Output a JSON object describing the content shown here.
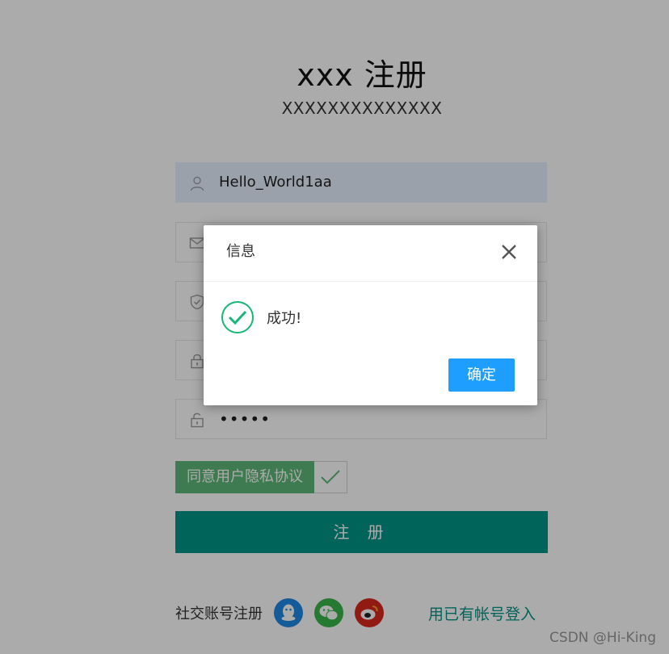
{
  "header": {
    "title": "xxx 注册",
    "subtitle": "XXXXXXXXXXXXXX"
  },
  "form": {
    "username_value": "Hello_World1aa",
    "confirm_password_mask": "•••••",
    "agree_label": "同意用户隐私协议",
    "agree_checked": true,
    "register_label": "注 册"
  },
  "footer": {
    "social_label": "社交账号注册",
    "social_icons": [
      "qq-icon",
      "wechat-icon",
      "weibo-icon"
    ],
    "login_link": "用已有帐号登入"
  },
  "watermark": "CSDN @Hi-King",
  "dialog": {
    "title": "信息",
    "message": "成功!",
    "ok_label": "确定"
  },
  "colors": {
    "primary": "#009688",
    "agree": "#5fb878",
    "dialog_button": "#1e9fff",
    "success_icon": "#16b777",
    "qq": "#1e88e5",
    "wechat": "#3ab54a",
    "weibo": "#d9271c"
  }
}
